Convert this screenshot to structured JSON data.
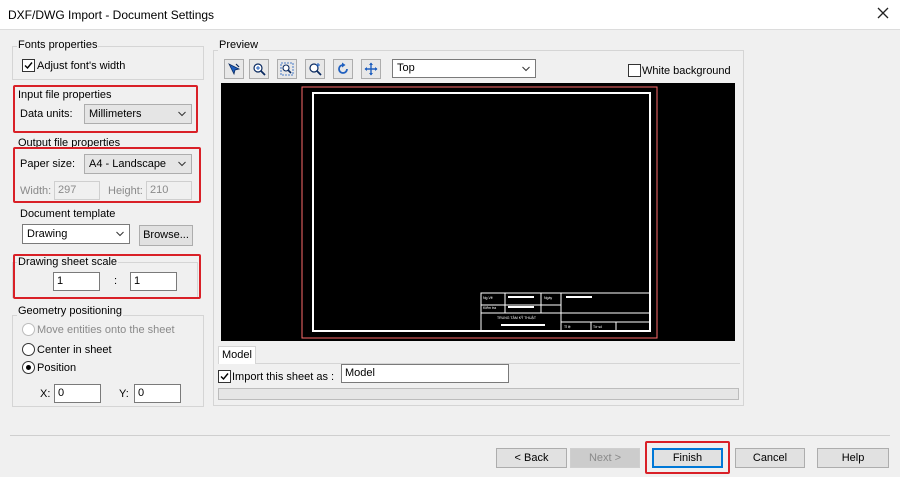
{
  "window": {
    "title": "DXF/DWG Import - Document Settings",
    "close_icon": "close-icon"
  },
  "fonts": {
    "group_label": "Fonts properties",
    "adjust_width_label": "Adjust font's width",
    "adjust_width_checked": true
  },
  "input_file": {
    "group_label": "Input file properties",
    "data_units_label": "Data units:",
    "data_units_value": "Millimeters"
  },
  "output_file": {
    "group_label": "Output file properties",
    "paper_size_label": "Paper size:",
    "paper_size_value": "A4 - Landscape",
    "width_label": "Width:",
    "width_value": "297",
    "height_label": "Height:",
    "height_value": "210"
  },
  "template": {
    "group_label": "Document template",
    "value": "Drawing",
    "browse_label": "Browse..."
  },
  "scale": {
    "group_label": "Drawing sheet scale",
    "left_value": "1",
    "separator": ":",
    "right_value": "1"
  },
  "geometry": {
    "group_label": "Geometry positioning",
    "move_label": "Move entities onto the sheet",
    "center_label": "Center in sheet",
    "position_label": "Position",
    "selected": "Position",
    "x_label": "X:",
    "x_value": "0",
    "y_label": "Y:",
    "y_value": "0"
  },
  "preview": {
    "group_label": "Preview",
    "toolbar_icons": [
      "select-icon",
      "zoom-in-icon",
      "zoom-extents-icon",
      "zoom-window-icon",
      "rotate-icon",
      "pan-icon"
    ],
    "view_value": "Top",
    "white_background_label": "White background",
    "white_background_checked": false,
    "tab_label": "Model",
    "import_label": "Import this sheet as :",
    "import_checked": true,
    "import_name": "Model",
    "title_block_texts": [
      "Ng.Vẽ",
      "Kiểm tra",
      "Ngày",
      "TRUNG TÂM KỸ THUẬT",
      "Tỉ lệ",
      "Tờ số"
    ]
  },
  "footer": {
    "back_label": "< Back",
    "next_label": "Next >",
    "finish_label": "Finish",
    "cancel_label": "Cancel",
    "help_label": "Help"
  },
  "colors": {
    "highlight": "#d92027",
    "default_button": "#0078d7",
    "preview_frame": "#ffffff",
    "preview_outer_frame": "#ff6060"
  }
}
